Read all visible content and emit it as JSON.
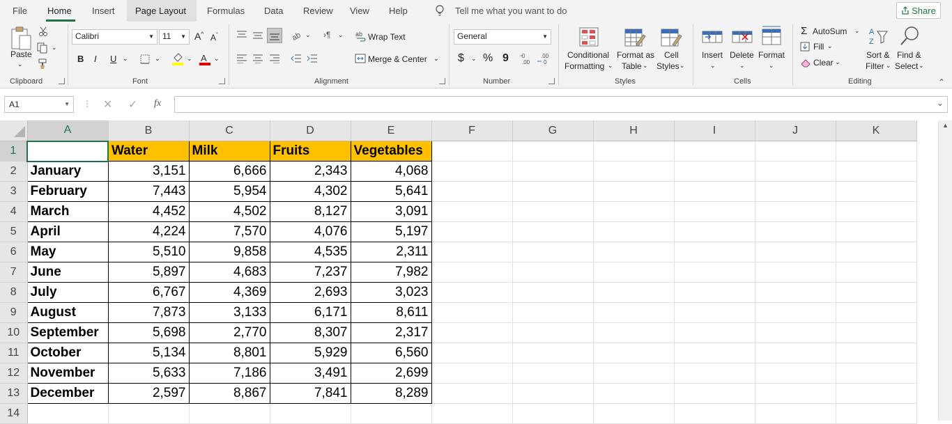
{
  "menu": {
    "tabs": [
      "File",
      "Home",
      "Insert",
      "Page Layout",
      "Formulas",
      "Data",
      "Review",
      "View",
      "Help"
    ],
    "tell_me": "Tell me what you want to do",
    "share": "Share"
  },
  "ribbon": {
    "clipboard": {
      "paste": "Paste",
      "label": "Clipboard"
    },
    "font": {
      "name": "Calibri",
      "size": "11",
      "bold": "B",
      "italic": "I",
      "underline": "U",
      "label": "Font"
    },
    "alignment": {
      "wrap": "Wrap Text",
      "merge": "Merge & Center",
      "label": "Alignment"
    },
    "number": {
      "format": "General",
      "currency": "$",
      "percent": "%",
      "comma": "9",
      "label": "Number"
    },
    "styles": {
      "conditional1": "Conditional",
      "conditional2": "Formatting",
      "format_table1": "Format as",
      "format_table2": "Table",
      "cell_styles1": "Cell",
      "cell_styles2": "Styles",
      "label": "Styles"
    },
    "cells": {
      "insert": "Insert",
      "delete": "Delete",
      "format": "Format",
      "label": "Cells"
    },
    "editing": {
      "autosum": "AutoSum",
      "fill": "Fill",
      "clear": "Clear",
      "sort1": "Sort &",
      "sort2": "Filter",
      "find1": "Find &",
      "find2": "Select",
      "label": "Editing"
    }
  },
  "formula_bar": {
    "name_box": "A1",
    "fx": "fx",
    "value": ""
  },
  "sheet": {
    "columns": [
      "A",
      "B",
      "C",
      "D",
      "E",
      "F",
      "G",
      "H",
      "I",
      "J",
      "K"
    ],
    "headers": [
      "",
      "Water",
      "Milk",
      "Fruits",
      "Vegetables"
    ],
    "rows": [
      {
        "n": "2",
        "month": "January",
        "values": [
          "3,151",
          "6,666",
          "2,343",
          "4,068"
        ]
      },
      {
        "n": "3",
        "month": "February",
        "values": [
          "7,443",
          "5,954",
          "4,302",
          "5,641"
        ]
      },
      {
        "n": "4",
        "month": "March",
        "values": [
          "4,452",
          "4,502",
          "8,127",
          "3,091"
        ]
      },
      {
        "n": "5",
        "month": "April",
        "values": [
          "4,224",
          "7,570",
          "4,076",
          "5,197"
        ]
      },
      {
        "n": "6",
        "month": "May",
        "values": [
          "5,510",
          "9,858",
          "4,535",
          "2,311"
        ]
      },
      {
        "n": "7",
        "month": "June",
        "values": [
          "5,897",
          "4,683",
          "7,237",
          "7,982"
        ]
      },
      {
        "n": "8",
        "month": "July",
        "values": [
          "6,767",
          "4,369",
          "2,693",
          "3,023"
        ]
      },
      {
        "n": "9",
        "month": "August",
        "values": [
          "7,873",
          "3,133",
          "6,171",
          "8,611"
        ]
      },
      {
        "n": "10",
        "month": "September",
        "values": [
          "5,698",
          "2,770",
          "8,307",
          "2,317"
        ]
      },
      {
        "n": "11",
        "month": "October",
        "values": [
          "5,134",
          "8,801",
          "5,929",
          "6,560"
        ]
      },
      {
        "n": "12",
        "month": "November",
        "values": [
          "5,633",
          "7,186",
          "3,491",
          "2,699"
        ]
      },
      {
        "n": "13",
        "month": "December",
        "values": [
          "2,597",
          "8,867",
          "7,841",
          "8,289"
        ]
      }
    ],
    "extra_rows": [
      "1",
      "14"
    ]
  },
  "colors": {
    "accent": "#217346",
    "header_fill": "#ffc000"
  }
}
